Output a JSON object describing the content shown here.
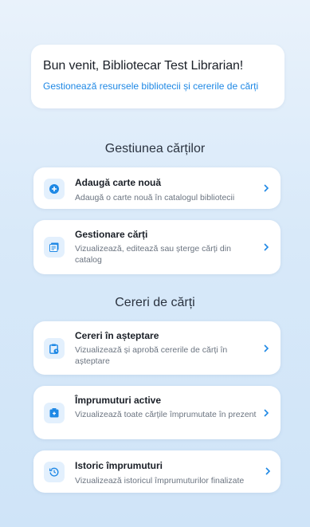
{
  "welcome": {
    "title": "Bun venit, Bibliotecar Test Librarian!",
    "subtitle": "Gestionează resursele bibliotecii și cererile de cărți"
  },
  "sections": {
    "books_title": "Gestiunea cărților",
    "requests_title": "Cereri de cărți"
  },
  "cards": [
    {
      "title": "Adaugă carte nouă",
      "description": "Adaugă o carte nouă în catalogul bibliotecii",
      "icon": "add-circle-icon"
    },
    {
      "title": "Gestionare cărți",
      "description": "Vizualizează, editează sau șterge cărți din catalog",
      "icon": "book-list-icon"
    },
    {
      "title": "Cereri în așteptare",
      "description": "Vizualizează și aprobă cererile de cărți în așteptare",
      "icon": "clipboard-pending-icon"
    },
    {
      "title": "Împrumuturi active",
      "description": "Vizualizează toate cărțile împrumutate în prezent",
      "icon": "active-loan-icon"
    },
    {
      "title": "Istoric împrumuturi",
      "description": "Vizualizează istoricul împrumuturilor finalizate",
      "icon": "history-icon"
    }
  ],
  "colors": {
    "accent": "#1e88e5",
    "icon_bg": "#e3f0fd",
    "background": "#d8e9f9"
  }
}
